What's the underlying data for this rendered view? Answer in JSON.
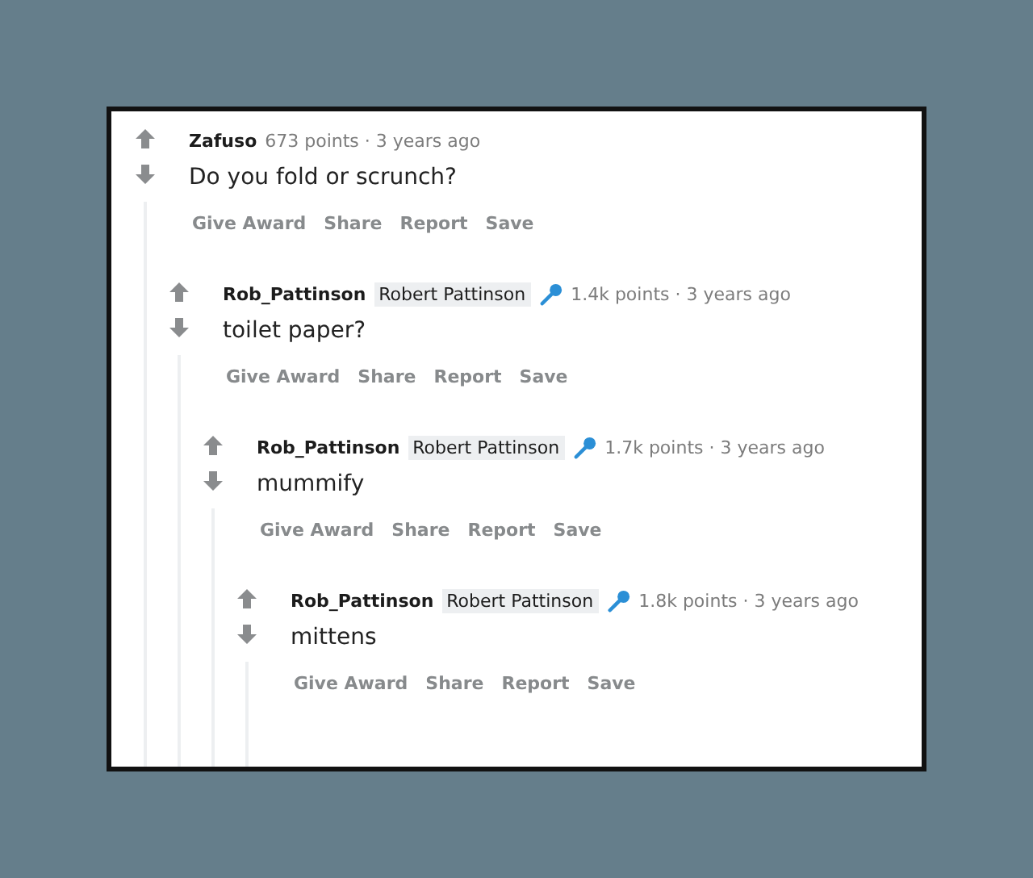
{
  "comments": [
    {
      "author": "Zafuso",
      "mic": false,
      "meta": "673 points · 3 years ago",
      "body": "Do you fold or scrunch?",
      "actions": [
        "Give Award",
        "Share",
        "Report",
        "Save"
      ],
      "children": [
        {
          "author": "Rob_Pattinson",
          "flair": "Robert Pattinson",
          "mic": true,
          "meta": "1.4k points · 3 years ago",
          "body": "toilet paper?",
          "actions": [
            "Give Award",
            "Share",
            "Report",
            "Save"
          ],
          "children": [
            {
              "author": "Rob_Pattinson",
              "flair": "Robert Pattinson",
              "mic": true,
              "meta": "1.7k points · 3 years ago",
              "body": "mummify",
              "actions": [
                "Give Award",
                "Share",
                "Report",
                "Save"
              ],
              "children": [
                {
                  "author": "Rob_Pattinson",
                  "flair": "Robert Pattinson",
                  "mic": true,
                  "meta": "1.8k points · 3 years ago",
                  "body": "mittens",
                  "actions": [
                    "Give Award",
                    "Share",
                    "Report",
                    "Save"
                  ]
                }
              ]
            }
          ]
        }
      ]
    }
  ]
}
